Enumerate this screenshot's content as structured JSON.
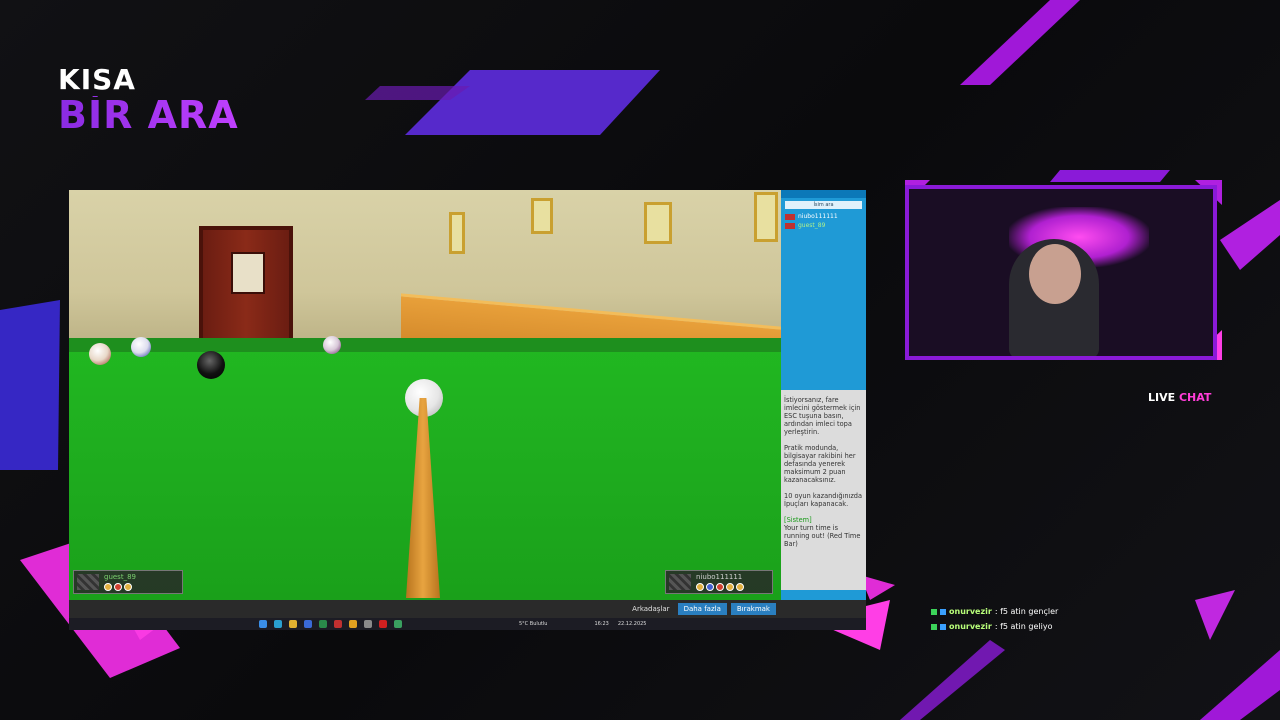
{
  "brand": {
    "line1": "KISA",
    "line2": "BİR ARA"
  },
  "game": {
    "sidebar": {
      "search_placeholder": "İsim ara",
      "players": [
        "niubo111111",
        "guest_89"
      ]
    },
    "help_text": [
      "İstiyorsanız, fare imlecini göstermek için ESC tuşuna basın, ardından imleci topa yerleştirin.",
      "Pratik modunda, bilgisayar rakibini her defasında yenerek maksimum 2 puan kazanacaksınız.",
      "10 oyun kazandığınızda İpuçları kapanacak."
    ],
    "system_label": "[Sistem]",
    "system_msg": "Your turn time is running out! (Red Time Bar)",
    "player_left": "guest_89",
    "player_right": "niubo111111",
    "bottom_bar": {
      "friends": "Arkadaşlar",
      "more": "Daha fazla",
      "leave": "Bırakmak"
    },
    "taskbar": {
      "weather": "5°C Bulutlu",
      "time": "16:23",
      "date": "22.12.2025"
    }
  },
  "stream": {
    "live_chat_prefix": "LIVE",
    "live_chat_accent": "CHAT",
    "chat": [
      {
        "user": "onurvezir",
        "text": ": f5 atin gençler"
      },
      {
        "user": "onurvezir",
        "text": ": f5 atin geliyo"
      }
    ]
  },
  "colors": {
    "accent_purple": "#8a2be2",
    "accent_pink": "#ff3dd8",
    "felt": "#1fae1f",
    "sidebar_blue": "#1f9ad6"
  }
}
